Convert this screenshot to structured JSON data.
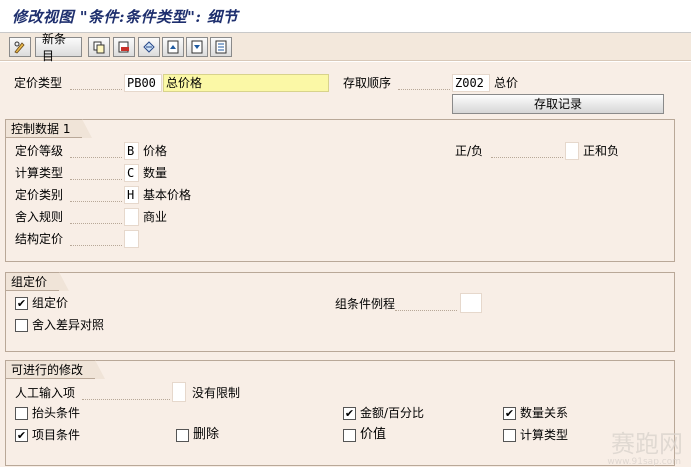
{
  "title": "修改视图 \"条件:条件类型\": 细节",
  "toolbar": {
    "new_entry_label": "新条目",
    "icons": [
      "edit-glasses-icon",
      "copy-icon",
      "delete-icon",
      "undo-icon",
      "first-entry-icon",
      "prev-entry-icon",
      "next-entry-icon"
    ]
  },
  "header": {
    "cond_type_label": "定价类型",
    "cond_type_value": "PB00",
    "cond_type_desc": "总价格",
    "access_seq_label": "存取顺序",
    "access_seq_value": "Z002",
    "access_seq_desc": "总价",
    "access_records_button": "存取记录"
  },
  "control": {
    "title": "控制数据 1",
    "rows": [
      {
        "label": "定价等级",
        "value": "B",
        "desc": "价格"
      },
      {
        "label": "计算类型",
        "value": "C",
        "desc": "数量"
      },
      {
        "label": "定价类别",
        "value": "H",
        "desc": "基本价格"
      },
      {
        "label": "舍入规则",
        "value": "",
        "desc": "商业"
      },
      {
        "label": "结构定价",
        "value": "",
        "desc": ""
      }
    ],
    "plus_minus_label": "正/负",
    "plus_minus_value": "",
    "plus_minus_desc": "正和负"
  },
  "group_cond": {
    "title": "组定价",
    "group_cond_label": "组定价",
    "group_cond_checked": true,
    "rounding_diff_label": "舍入差异对照",
    "rounding_diff_checked": false,
    "group_routine_label": "组条件例程",
    "group_routine_value": ""
  },
  "changes": {
    "title": "可进行的修改",
    "manual_entry_label": "人工输入项",
    "manual_entry_value": "",
    "manual_entry_desc": "没有限制",
    "header_cond_label": "抬头条件",
    "header_cond_checked": false,
    "item_cond_label": "项目条件",
    "item_cond_checked": true,
    "delete_label": "删除",
    "delete_checked": false,
    "amount_pct_label": "金额/百分比",
    "amount_pct_checked": true,
    "value_label": "价值",
    "value_checked": false,
    "qty_relation_label": "数量关系",
    "qty_relation_checked": true,
    "calc_type_label": "计算类型",
    "calc_type_checked": false
  },
  "watermark": {
    "text": "赛跑网",
    "url": "www.91sap.com"
  },
  "colors": {
    "accent_title": "#1e2f6e",
    "background": "#f8eee6",
    "highlight": "#fbf8a6"
  }
}
